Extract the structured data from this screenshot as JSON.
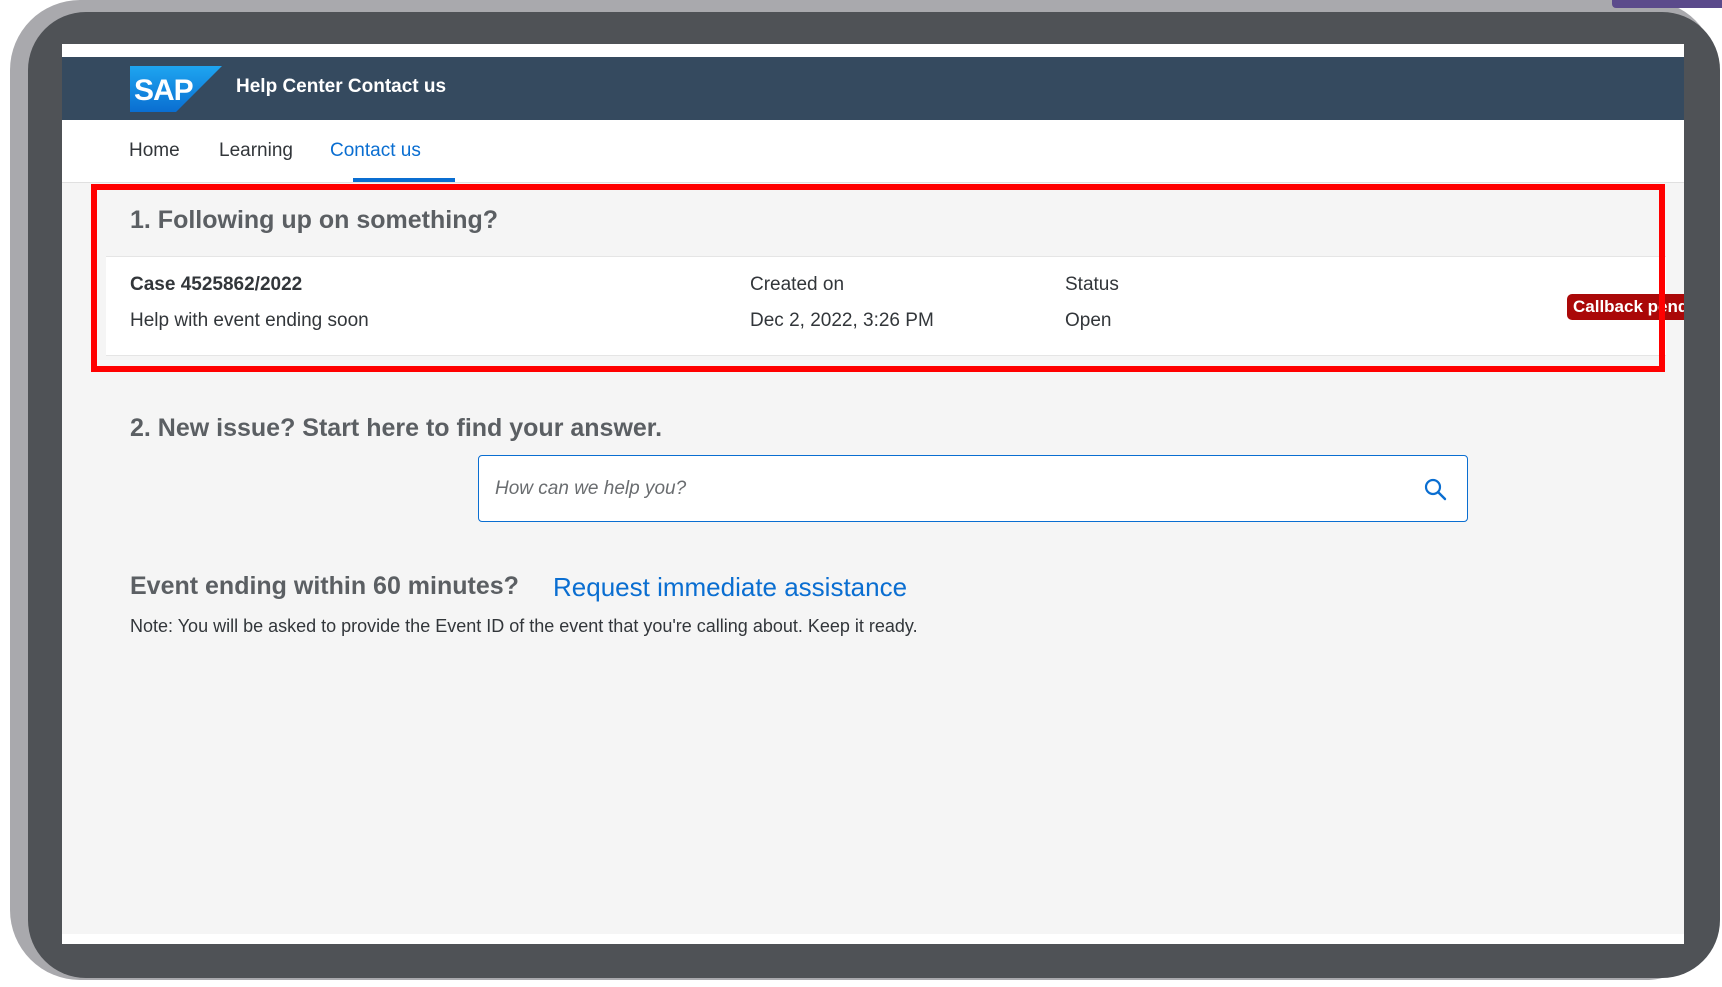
{
  "shellbar": {
    "logo_text": "SAP",
    "title": "Help Center Contact us"
  },
  "tabs": [
    {
      "label": "Home"
    },
    {
      "label": "Learning"
    },
    {
      "label": "Contact us"
    }
  ],
  "followup": {
    "title": "1. Following up on something?",
    "case": {
      "id_label": "Case 4525862/2022",
      "description": "Help with event ending soon",
      "created_header": "Created on",
      "created_value": "Dec 2, 2022, 3:26 PM",
      "status_header": "Status",
      "status_value": "Open",
      "badge": "Callback pending"
    }
  },
  "new_issue": {
    "title": "2. New issue? Start here to find your answer.",
    "search_placeholder": "How can we help you?"
  },
  "urgent": {
    "title": "Event ending within 60 minutes?",
    "link": "Request immediate assistance",
    "note": "Note: You will be asked to provide the Event ID of the event that you're calling about. Keep it ready."
  },
  "colors": {
    "shellbar": "#354a5f",
    "accent": "#0a6ed1",
    "badge": "#aa0808",
    "highlight": "#ff0000"
  }
}
